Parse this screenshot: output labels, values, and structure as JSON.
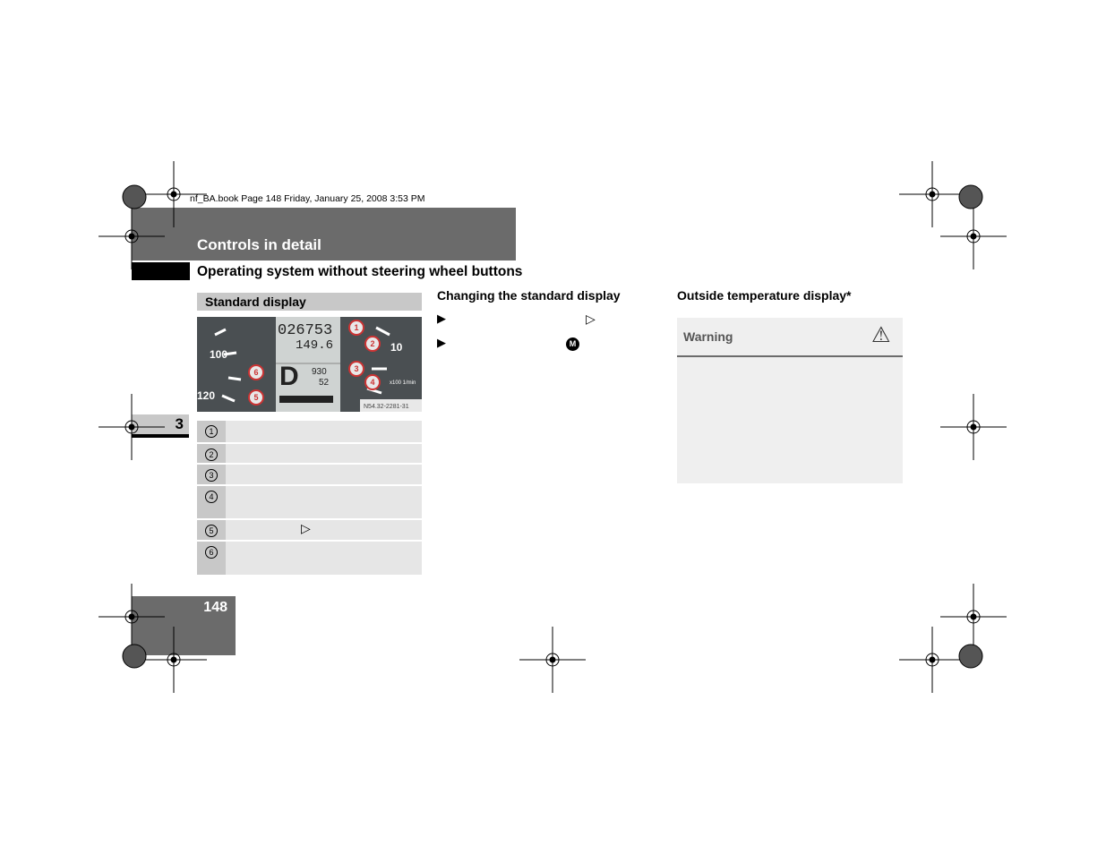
{
  "file_meta": "nf_BA.book  Page 148  Friday, January 25, 2008  3:53 PM",
  "header": {
    "section_title": "Controls in detail",
    "subheading": "Operating system without steering wheel buttons"
  },
  "left": {
    "box_title": "Standard display",
    "figure": {
      "odometer": "026753",
      "trip": "149.6",
      "gear": "D",
      "value1": "930",
      "value2": "52",
      "speed_labels": [
        "100",
        "120"
      ],
      "rpm_label": "10",
      "rpm_unit": "x100 1/min",
      "callouts": [
        "1",
        "2",
        "3",
        "4",
        "5",
        "6"
      ],
      "figure_code": "N54.32-2281-31"
    },
    "rows": [
      {
        "num": "1"
      },
      {
        "num": "2"
      },
      {
        "num": "3"
      },
      {
        "num": "4"
      },
      {
        "num": "5",
        "symbol": "▷"
      },
      {
        "num": "6"
      }
    ]
  },
  "middle": {
    "heading": "Changing the standard display",
    "bullets": [
      {
        "marker": "▶",
        "symbol": "▷"
      },
      {
        "marker": "▶",
        "symbol": "M"
      }
    ]
  },
  "right": {
    "heading": "Outside temperature display*",
    "warning_label": "Warning",
    "warning_icon": "⚠"
  },
  "chapter": "3",
  "page_number": "148"
}
